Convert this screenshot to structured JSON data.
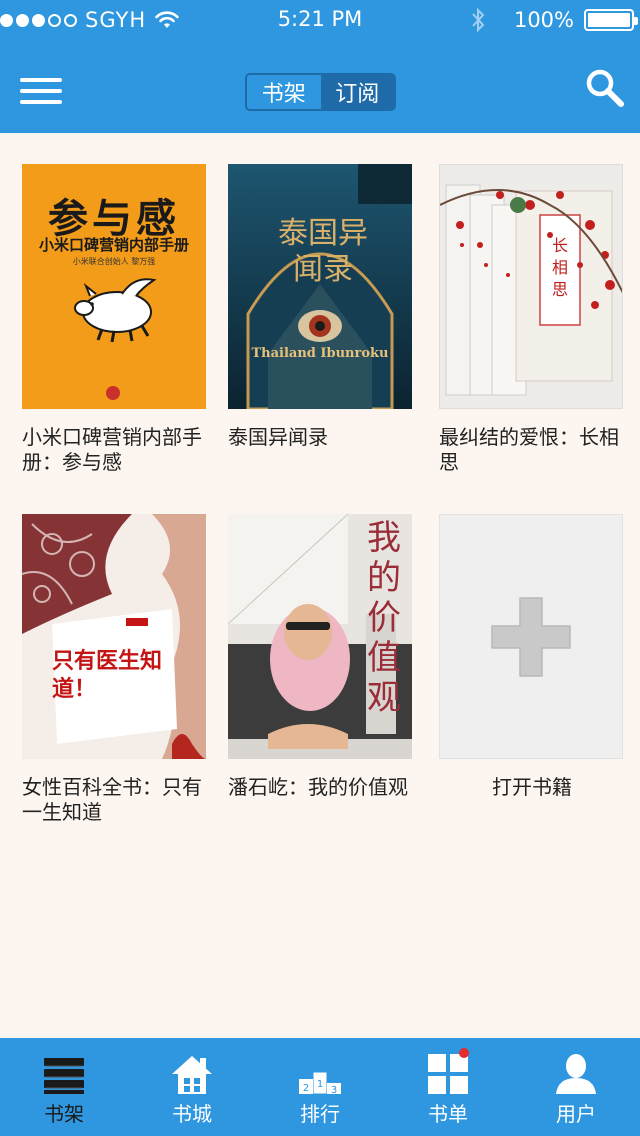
{
  "status_bar": {
    "carrier": "SGYH",
    "time": "5:21 PM",
    "battery": "100%"
  },
  "header": {
    "segments": [
      {
        "label": "书架",
        "active": true
      },
      {
        "label": "订阅",
        "active": false
      }
    ]
  },
  "colors": {
    "primary": "#2f97e0",
    "background": "#fdf6f0",
    "badge": "#e52d2d"
  },
  "books": [
    {
      "title": "小米口碑营销内部手册：参与感",
      "cover": {
        "title": "参与感",
        "subtitle": "小米口碑营销内部手册",
        "author": "小米联合创始人 黎万强"
      }
    },
    {
      "title": "泰国异闻录",
      "cover": {
        "title": "泰国异闻录",
        "english": "Thailand Ibunroku"
      }
    },
    {
      "title": "最纠结的爱恨：长相思",
      "cover": {
        "title": "长相思"
      }
    },
    {
      "title": "女性百科全书：只有一生知道",
      "cover": {
        "title": "只有医生知道！"
      }
    },
    {
      "title": "潘石屹：我的价值观",
      "cover": {
        "title": "我的价值观"
      }
    }
  ],
  "add_book": {
    "label": "打开书籍",
    "icon": "plus-icon"
  },
  "tabs": [
    {
      "label": "书架",
      "icon": "bookshelf-icon",
      "active": true
    },
    {
      "label": "书城",
      "icon": "house-icon",
      "active": false
    },
    {
      "label": "排行",
      "icon": "podium-icon",
      "active": false
    },
    {
      "label": "书单",
      "icon": "grid-icon",
      "active": false,
      "badge": true
    },
    {
      "label": "用户",
      "icon": "user-icon",
      "active": false
    }
  ]
}
